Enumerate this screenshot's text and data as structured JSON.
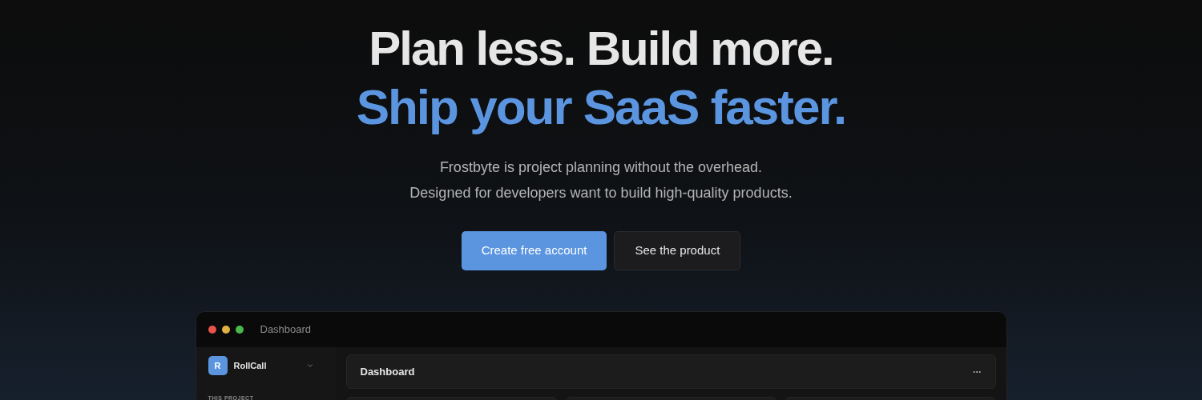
{
  "hero": {
    "headline": "Plan less. Build more.",
    "tagline": "Ship your SaaS faster.",
    "description": [
      "Frostbyte is project planning without the overhead.",
      "Designed for developers want to build high-quality products."
    ]
  },
  "buttons": [
    {
      "label": "Create free account",
      "kind": "primary"
    },
    {
      "label": "See the product",
      "kind": "secondary"
    }
  ],
  "app_window": {
    "title": "Dashboard",
    "project": {
      "initial": "R",
      "name": "RollCall"
    },
    "sidebar_section": "THIS PROJECT",
    "header": {
      "title": "Dashboard"
    }
  }
}
